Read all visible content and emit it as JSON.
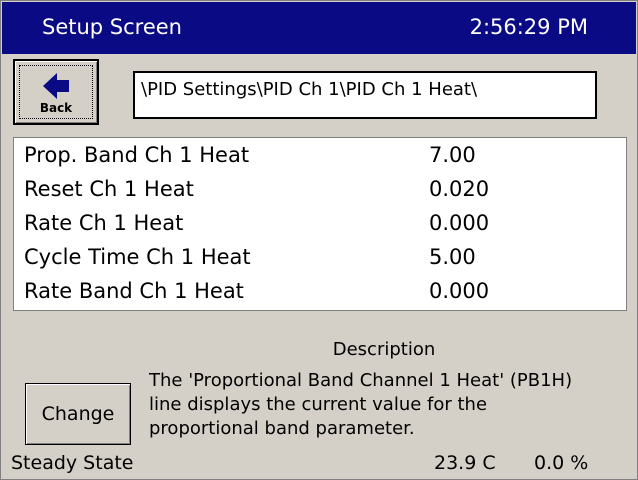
{
  "header": {
    "title": "Setup Screen",
    "time": "2:56:29 PM"
  },
  "toolbar": {
    "back_label": "Back",
    "back_icon": "left-arrow-icon",
    "path": "\\PID Settings\\PID Ch 1\\PID Ch 1 Heat\\"
  },
  "parameters": [
    {
      "name": "Prop. Band Ch 1 Heat",
      "value": "7.00"
    },
    {
      "name": "Reset Ch 1 Heat",
      "value": "0.020"
    },
    {
      "name": "Rate Ch 1 Heat",
      "value": "0.000"
    },
    {
      "name": "Cycle Time Ch 1 Heat",
      "value": "5.00"
    },
    {
      "name": "Rate Band Ch 1 Heat",
      "value": "0.000"
    }
  ],
  "description": {
    "heading": "Description",
    "lines": [
      "The 'Proportional Band Channel 1 Heat' (PB1H)",
      "line displays the current value for the",
      "proportional band parameter."
    ]
  },
  "actions": {
    "change_label": "Change"
  },
  "status": {
    "state": "Steady State",
    "temperature": "23.9 C",
    "percent": "0.0 %"
  },
  "colors": {
    "titlebar": "#0a0a84",
    "background": "#d4d0c8",
    "list_background": "#ffffff"
  }
}
